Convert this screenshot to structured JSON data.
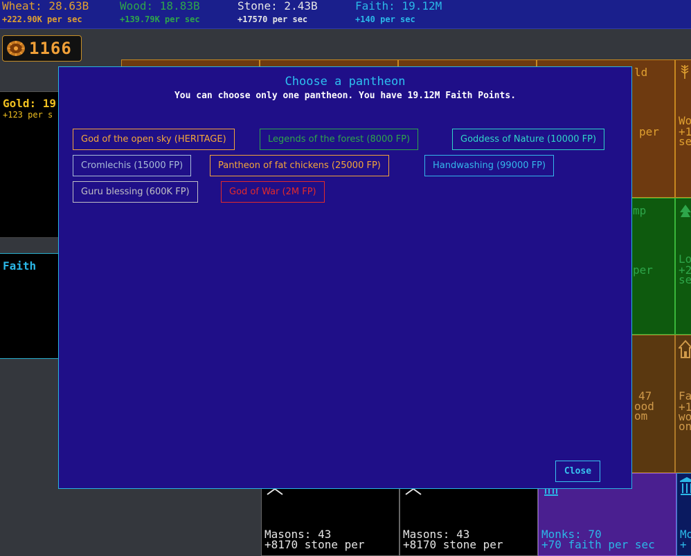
{
  "resources": [
    {
      "name": "Wheat: 28.63B",
      "rate": "+222.90K per sec",
      "color": "#e0a030"
    },
    {
      "name": "Wood: 18.83B",
      "rate": "+139.79K per sec",
      "color": "#2ea64a"
    },
    {
      "name": "Stone: 2.43B",
      "rate": "+17570 per sec",
      "color": "#e6e6e6"
    },
    {
      "name": "Faith: 19.12M",
      "rate": "+140 per sec",
      "color": "#2bb8e8"
    }
  ],
  "coin_counter": {
    "value": "1166",
    "icon": "coin-stack-icon"
  },
  "side_panels": {
    "gold": {
      "title": "Gold: 19",
      "rate": "+123 per s"
    },
    "faith": {
      "title": "Faith"
    }
  },
  "background_cards": {
    "top_right_1": {
      "text1": "ld",
      "text2": "per"
    },
    "top_right_2": {
      "text1": "Wo",
      "text2": "+1",
      "text3": "se"
    },
    "mid_right_1": {
      "text1": "mp",
      "text2": "per"
    },
    "mid_right_2": {
      "text1": "Lo",
      "text2": "+2",
      "text3": "se"
    },
    "low_right_1": {
      "text1": "47",
      "text2": "ood",
      "text3": "om"
    },
    "low_right_2": {
      "text1": "Fa",
      "text2": "+1",
      "text3": "wo",
      "text4": "on"
    },
    "bottom": [
      {
        "title": "Masons: 43",
        "rate": "+8170 stone per"
      },
      {
        "title": "Masons: 43",
        "rate": "+8170 stone per"
      },
      {
        "title": "Monks: 70",
        "rate": "+70 faith per sec"
      },
      {
        "title": "Mo",
        "rate": "+"
      }
    ]
  },
  "modal": {
    "title": "Choose a pantheon",
    "subtitle": "You can choose only one pantheon. You have 19.12M Faith Points.",
    "pantheons": [
      {
        "label": "God of the open sky (HERITAGE)",
        "color": "orange"
      },
      {
        "label": "Legends of the forest (8000 FP)",
        "color": "green"
      },
      {
        "label": "Goddess of Nature (10000 FP)",
        "color": "teal"
      },
      {
        "label": "Cromlechis (15000 FP)",
        "color": "slate"
      },
      {
        "label": "Pantheon of fat chickens (25000 FP)",
        "color": "orange"
      },
      {
        "label": "Handwashing (99000 FP)",
        "color": "sky"
      },
      {
        "label": "Guru blessing (600K FP)",
        "color": "grey"
      },
      {
        "label": "God of War (2M FP)",
        "color": "red"
      }
    ],
    "close_label": "Close"
  }
}
